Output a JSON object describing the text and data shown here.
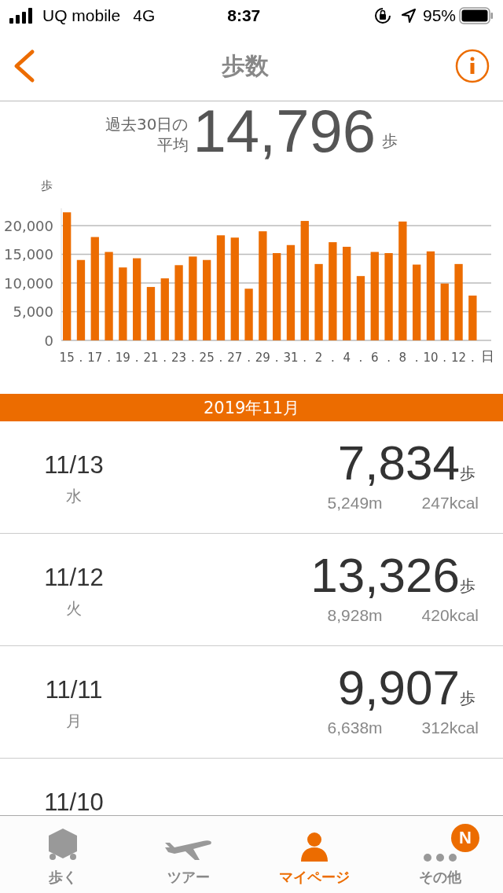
{
  "status_bar": {
    "carrier": "UQ mobile",
    "network": "4G",
    "time": "8:37",
    "battery": "95%"
  },
  "nav": {
    "title": "歩数"
  },
  "average": {
    "label_line1": "過去30日の",
    "label_line2": "平均",
    "value": "14,796",
    "unit": "歩"
  },
  "chart_data": {
    "type": "bar",
    "ylabel": "歩",
    "xlabel": "日",
    "categories": [
      "15",
      ".",
      "17",
      ".",
      "19",
      ".",
      "21",
      ".",
      "23",
      ".",
      "25",
      ".",
      "27",
      ".",
      "29",
      ".",
      "31",
      ".",
      "2",
      ".",
      "4",
      ".",
      "6",
      ".",
      "8",
      ".",
      "10",
      ".",
      "12",
      "."
    ],
    "series": [
      {
        "color": "#ec6c00",
        "values": [
          22300,
          14000,
          18000,
          15400,
          12700,
          14300,
          9300,
          10800,
          13100,
          14600,
          14000,
          18300,
          17900,
          9000,
          19000,
          15200,
          16600,
          20800,
          13300,
          17100,
          16300,
          11200,
          15400,
          15200,
          20700,
          13200,
          15500,
          9900,
          13300,
          7800
        ]
      }
    ],
    "ylim": [
      0,
      23000
    ],
    "grid": true,
    "yticks": [
      {
        "value": 0,
        "label": "0"
      },
      {
        "value": 5000,
        "label": "5,000"
      },
      {
        "value": 10000,
        "label": "10,000"
      },
      {
        "value": 15000,
        "label": "15,000"
      },
      {
        "value": 20000,
        "label": "20,000"
      }
    ]
  },
  "month_header": "2019年11月",
  "days": [
    {
      "date": "11/13",
      "weekday": "水",
      "steps": "7,834",
      "unit": "歩",
      "distance": "5,249m",
      "calories": "247kcal"
    },
    {
      "date": "11/12",
      "weekday": "火",
      "steps": "13,326",
      "unit": "歩",
      "distance": "8,928m",
      "calories": "420kcal"
    },
    {
      "date": "11/11",
      "weekday": "月",
      "steps": "9,907",
      "unit": "歩",
      "distance": "6,638m",
      "calories": "312kcal"
    },
    {
      "date": "11/10"
    }
  ],
  "tabs": [
    {
      "kind": "walk",
      "label": "歩く",
      "selected": false
    },
    {
      "kind": "tour",
      "label": "ツアー",
      "selected": false
    },
    {
      "kind": "mypage",
      "label": "マイページ",
      "selected": true
    },
    {
      "kind": "other",
      "label": "その他",
      "selected": false,
      "badge": "N"
    }
  ]
}
